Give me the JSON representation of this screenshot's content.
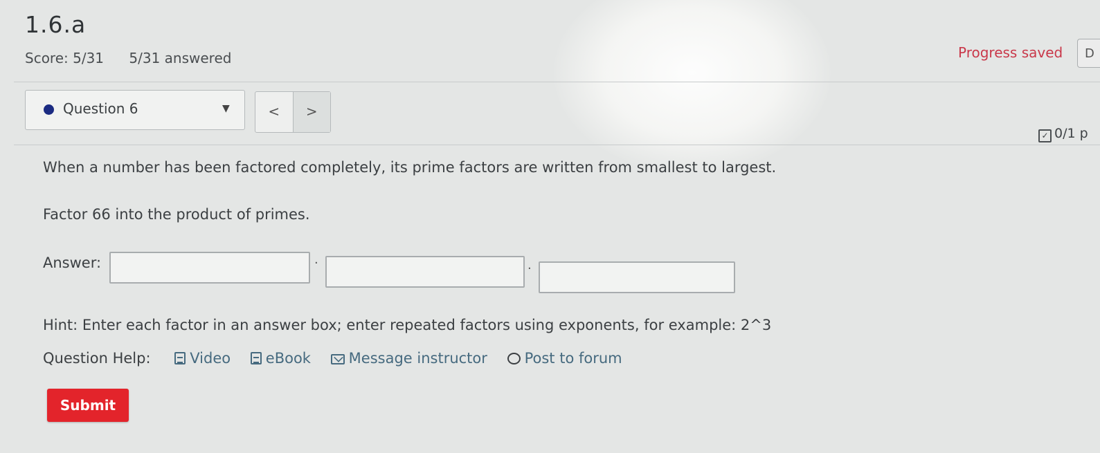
{
  "header": {
    "title": "1.6.a",
    "score": "Score: 5/31",
    "answered": "5/31 answered",
    "progress_status": "Progress saved",
    "top_right_button": "D"
  },
  "question_nav": {
    "selected_question": "Question 6",
    "prev_label": "<",
    "next_label": ">"
  },
  "points": "0/1 p",
  "question": {
    "intro": "When a number has been factored completely, its prime factors are written from smallest to largest.",
    "instruction": "Factor 66 into the product of primes.",
    "answer_label": "Answer:",
    "answer_boxes": [
      {
        "value": ""
      },
      {
        "value": ""
      },
      {
        "value": ""
      }
    ],
    "separator": "·",
    "hint": "Hint: Enter each factor in an answer box; enter repeated factors using exponents, for example: 2^3"
  },
  "help": {
    "label": "Question Help:",
    "links": {
      "video": "Video",
      "ebook": "eBook",
      "message": "Message instructor",
      "forum": "Post to forum"
    }
  },
  "submit_label": "Submit",
  "colors": {
    "accent_red": "#e3242b",
    "progress_text": "#c9384a",
    "link": "#466a7f",
    "status_dot": "#1b2b82"
  }
}
